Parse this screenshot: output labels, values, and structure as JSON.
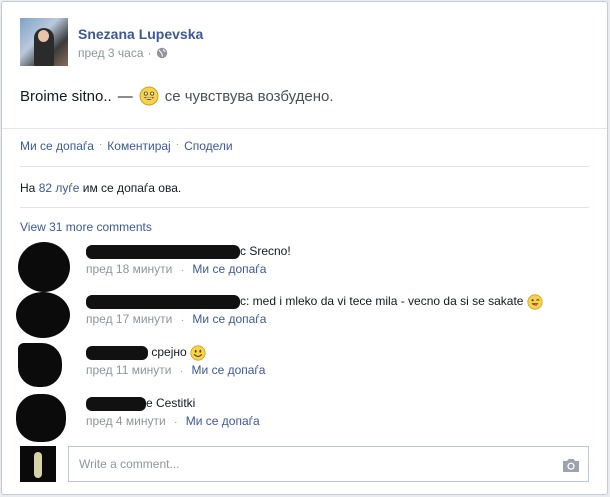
{
  "post": {
    "author": "Snezana Lupevska",
    "time": "пред 3 часа",
    "text": "Broime sitno..",
    "dash": "—",
    "feeling": "се чувствува возбудено."
  },
  "actions": {
    "like": "Ми се допаѓа",
    "comment": "Коментирај",
    "share": "Сподели",
    "separator": "·"
  },
  "likes": {
    "prefix": "На",
    "count_link": "82 луѓе",
    "suffix": "им се допаѓа ова."
  },
  "comments_section": {
    "view_more": "View 31 more comments",
    "items": [
      {
        "visible_text": "c Srecno!",
        "time": "пред 18 минути",
        "like": "Ми се допаѓа"
      },
      {
        "visible_text": "c: med i mleko da vi tece mila - vecno da si se sakate",
        "time": "пред 17 минути",
        "like": "Ми се допаѓа"
      },
      {
        "visible_text": "срејно",
        "time": "пред 11 минути",
        "like": "Ми се допаѓа"
      },
      {
        "visible_text": "e Cestitki",
        "time": "пред 4 минути",
        "like": "Ми се допаѓа"
      }
    ]
  },
  "composer": {
    "placeholder": "Write a comment..."
  },
  "icons": {
    "globe": "globe-icon",
    "feeling": "excited-emoji-icon",
    "wink": "wink-emoji-icon",
    "smile": "smile-emoji-icon",
    "camera": "camera-icon"
  },
  "colors": {
    "link": "#3b5998",
    "meta": "#90949c",
    "text": "#141823"
  }
}
